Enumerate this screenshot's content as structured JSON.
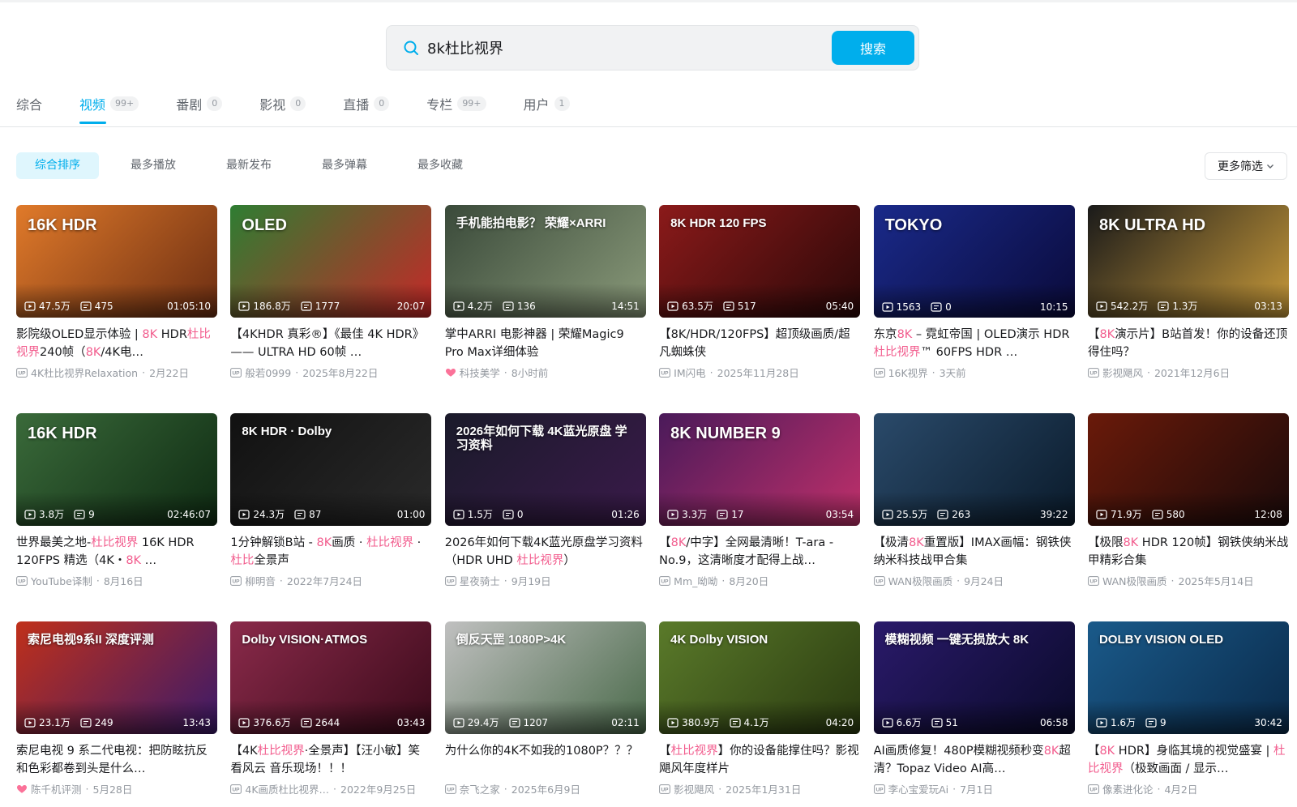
{
  "search": {
    "value": "8k杜比视界",
    "button": "搜索"
  },
  "tabs": [
    {
      "label": "综合",
      "badge": ""
    },
    {
      "label": "视频",
      "badge": "99+",
      "active": true
    },
    {
      "label": "番剧",
      "badge": "0"
    },
    {
      "label": "影视",
      "badge": "0"
    },
    {
      "label": "直播",
      "badge": "0"
    },
    {
      "label": "专栏",
      "badge": "99+"
    },
    {
      "label": "用户",
      "badge": "1"
    }
  ],
  "sort_options": [
    "综合排序",
    "最多播放",
    "最新发布",
    "最多弹幕",
    "最多收藏"
  ],
  "filter_label": "更多筛选",
  "colors": {
    "accent": "#00aeec",
    "highlight": "#f25d8e",
    "muted": "#9499a0"
  },
  "videos": [
    {
      "thumb_text": "16K HDR",
      "thumb_colors": [
        "#e07a2a",
        "#6b2d12"
      ],
      "views": "47.5万",
      "danmaku": "475",
      "duration": "01:05:10",
      "title": [
        "影院级OLED显示体验 | ",
        {
          "hl": "8K"
        },
        " HDR",
        {
          "hl": "杜比视界"
        },
        "240帧（",
        {
          "hl": "8K"
        },
        "/4K电…"
      ],
      "author": "4K杜比视界Relaxation",
      "date": "2月22日",
      "author_icon": "up-icon"
    },
    {
      "thumb_text": "OLED",
      "thumb_colors": [
        "#2e7d32",
        "#c62828"
      ],
      "views": "186.8万",
      "danmaku": "1777",
      "duration": "20:07",
      "title": [
        "【4KHDR 真彩®】《最佳 4K HDR》—— ULTRA HD 60帧 …"
      ],
      "author": "般若0999",
      "date": "2025年8月22日",
      "author_icon": "up-icon"
    },
    {
      "thumb_text": "手机能拍电影？ 荣耀×ARRI",
      "thumb_colors": [
        "#3a4a3a",
        "#8a9a7a"
      ],
      "views": "4.2万",
      "danmaku": "136",
      "duration": "14:51",
      "title": [
        "掌中ARRI 电影神器 | 荣耀Magic9 Pro Max详细体验"
      ],
      "author": "科技美学",
      "date": "8小时前",
      "author_icon": "charge-icon"
    },
    {
      "thumb_text": "8K HDR 120 FPS",
      "thumb_colors": [
        "#8b1a1a",
        "#2a0808"
      ],
      "views": "63.5万",
      "danmaku": "517",
      "duration": "05:40",
      "title": [
        "【8K/HDR/120FPS】超顶级画质/超凡蜘蛛侠"
      ],
      "author": "IM闪电",
      "date": "2025年11月28日",
      "author_icon": "up-icon"
    },
    {
      "thumb_text": "TOKYO",
      "thumb_colors": [
        "#1a2a8a",
        "#0a0a3a"
      ],
      "views": "1563",
      "danmaku": "0",
      "duration": "10:15",
      "title": [
        "东京",
        {
          "hl": "8K"
        },
        " – 霓虹帝国 | OLED演示 HDR ",
        {
          "hl": "杜比视界"
        },
        "™ 60FPS HDR …"
      ],
      "author": "16K视界",
      "date": "3天前",
      "author_icon": "up-icon"
    },
    {
      "thumb_text": "8K ULTRA HD",
      "thumb_colors": [
        "#1a1a1a",
        "#c89a3a"
      ],
      "views": "542.2万",
      "danmaku": "1.3万",
      "duration": "03:13",
      "title": [
        "【",
        {
          "hl": "8K"
        },
        "演示片】B站首发！你的设备还顶得住吗？"
      ],
      "author": "影视飓风",
      "date": "2021年12月6日",
      "author_icon": "up-icon"
    },
    {
      "thumb_text": "16K HDR",
      "thumb_colors": [
        "#3a6a3a",
        "#0e2a12"
      ],
      "views": "3.8万",
      "danmaku": "9",
      "duration": "02:46:07",
      "title": [
        "世界最美之地-",
        {
          "hl": "杜比视界"
        },
        " 16K HDR 120FPS 精选（4K・",
        {
          "hl": "8K"
        },
        " …"
      ],
      "author": "YouTube译制",
      "date": "8月16日",
      "author_icon": "up-icon"
    },
    {
      "thumb_text": "8K HDR · Dolby",
      "thumb_colors": [
        "#111111",
        "#2a2a2a"
      ],
      "views": "24.3万",
      "danmaku": "87",
      "duration": "01:00",
      "title": [
        "1分钟解锁B站 - ",
        {
          "hl": "8K"
        },
        "画质 · ",
        {
          "hl": "杜比视界"
        },
        " · ",
        {
          "hl": "杜比"
        },
        "全景声"
      ],
      "author": "柳明音",
      "date": "2022年7月24日",
      "author_icon": "up-icon"
    },
    {
      "thumb_text": "2026年如何下载 4K蓝光原盘 学习资料",
      "thumb_colors": [
        "#1a1a2a",
        "#3a1a4a"
      ],
      "views": "1.5万",
      "danmaku": "0",
      "duration": "01:26",
      "title": [
        "2026年如何下载4K蓝光原盘学习资料（HDR UHD ",
        {
          "hl": "杜比视界"
        },
        "）"
      ],
      "author": "星夜骑士",
      "date": "9月19日",
      "author_icon": "up-icon"
    },
    {
      "thumb_text": "8K NUMBER 9",
      "thumb_colors": [
        "#4a1a5a",
        "#c0306a"
      ],
      "views": "3.3万",
      "danmaku": "17",
      "duration": "03:54",
      "title": [
        "【",
        {
          "hl": "8K"
        },
        "/中字】全网最清晰！T-ara - No.9，这清晰度才配得上战…"
      ],
      "author": "Mm_呦呦",
      "date": "8月20日",
      "author_icon": "up-icon"
    },
    {
      "thumb_text": "",
      "thumb_colors": [
        "#2a4a6a",
        "#0a1a2a"
      ],
      "views": "25.5万",
      "danmaku": "263",
      "duration": "39:22",
      "title": [
        "【极清",
        {
          "hl": "8K"
        },
        "重置版】IMAX画幅：钢铁侠纳米科技战甲合集"
      ],
      "author": "WAN极限画质",
      "date": "9月24日",
      "author_icon": "up-icon"
    },
    {
      "thumb_text": "",
      "thumb_colors": [
        "#6a1a0a",
        "#1a0a0a"
      ],
      "views": "71.9万",
      "danmaku": "580",
      "duration": "12:08",
      "title": [
        "【极限",
        {
          "hl": "8K"
        },
        " HDR 120帧】钢铁侠纳米战甲精彩合集"
      ],
      "author": "WAN极限画质",
      "date": "2025年5月14日",
      "author_icon": "up-icon"
    },
    {
      "thumb_text": "索尼电视9系II 深度评测",
      "thumb_colors": [
        "#c0301a",
        "#3a1a6a"
      ],
      "views": "23.1万",
      "danmaku": "249",
      "duration": "13:43",
      "title": [
        "索尼电视 9 系二代电视：把防眩抗反和色彩都卷到头是什么…"
      ],
      "author": "陈千机评测",
      "date": "5月28日",
      "author_icon": "charge-icon"
    },
    {
      "thumb_text": "Dolby VISION·ATMOS",
      "thumb_colors": [
        "#8a2a4a",
        "#3a0a1a"
      ],
      "views": "376.6万",
      "danmaku": "2644",
      "duration": "03:43",
      "title": [
        "【4K",
        {
          "hl": "杜比视界"
        },
        "·全景声】【汪小敏】笑看风云 音乐现场！！！"
      ],
      "author": "4K画质杜比视界…",
      "date": "2022年9月25日",
      "author_icon": "up-icon"
    },
    {
      "thumb_text": "倒反天罡 1080P>4K",
      "thumb_colors": [
        "#c0c0c0",
        "#4a6a4a"
      ],
      "views": "29.4万",
      "danmaku": "1207",
      "duration": "02:11",
      "title": [
        "为什么你的4K不如我的1080P？？？"
      ],
      "author": "奈飞之家",
      "date": "2025年6月9日",
      "author_icon": "up-icon"
    },
    {
      "thumb_text": "4K Dolby VISION",
      "thumb_colors": [
        "#5a7a2a",
        "#2a3a10"
      ],
      "views": "380.9万",
      "danmaku": "4.1万",
      "duration": "04:20",
      "title": [
        "【",
        {
          "hl": "杜比视界"
        },
        "】你的设备能撑住吗？影视飓风年度样片"
      ],
      "author": "影视飓风",
      "date": "2025年1月31日",
      "author_icon": "up-icon"
    },
    {
      "thumb_text": "模糊视频 一键无损放大 8K",
      "thumb_colors": [
        "#2a1a6a",
        "#0a0a2a"
      ],
      "views": "6.6万",
      "danmaku": "51",
      "duration": "06:58",
      "title": [
        "AI画质修复！480P模糊视频秒变",
        {
          "hl": "8K"
        },
        "超清？Topaz Video AI高…"
      ],
      "author": "李心宝爱玩Ai",
      "date": "7月1日",
      "author_icon": "up-icon"
    },
    {
      "thumb_text": "DOLBY VISION OLED",
      "thumb_colors": [
        "#1a5a8a",
        "#0a2a4a"
      ],
      "views": "1.6万",
      "danmaku": "9",
      "duration": "30:42",
      "title": [
        "【",
        {
          "hl": "8K"
        },
        " HDR】身临其境的视觉盛宴 | ",
        {
          "hl": "杜比视界"
        },
        "（极致画面 / 显示…"
      ],
      "author": "像素进化论",
      "date": "4月2日",
      "author_icon": "up-icon"
    }
  ]
}
